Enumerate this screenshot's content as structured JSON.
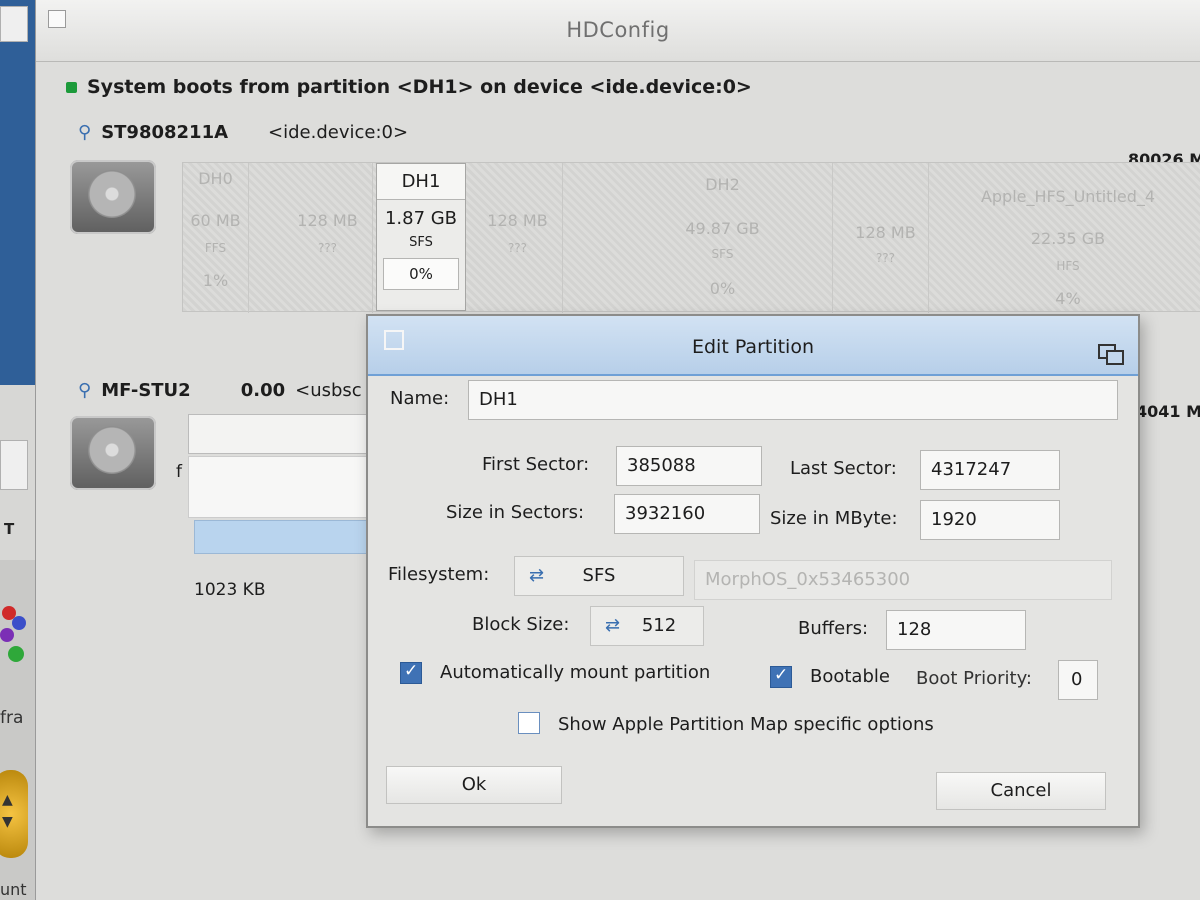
{
  "window": {
    "title": "HDConfig"
  },
  "boot_status": "System boots from partition <DH1> on device <ide.device:0>",
  "devices": [
    {
      "name": "ST9808211A",
      "path": "<ide.device:0>",
      "size": "80026 M",
      "partitions": [
        {
          "name": "DH0",
          "size": "60 MB",
          "fs": "FFS",
          "used": "1%"
        },
        {
          "name": "",
          "size": "128 MB",
          "fs": "???",
          "used": ""
        },
        {
          "name": "DH1",
          "size": "1.87 GB",
          "fs": "SFS",
          "used": "0%",
          "selected": true
        },
        {
          "name": "",
          "size": "128 MB",
          "fs": "???",
          "used": ""
        },
        {
          "name": "DH2",
          "size": "49.87 GB",
          "fs": "SFS",
          "used": "0%"
        },
        {
          "name": "",
          "size": "128 MB",
          "fs": "???",
          "used": ""
        },
        {
          "name": "Apple_HFS_Untitled_4",
          "size": "22.35 GB",
          "fs": "HFS",
          "used": "4%"
        }
      ]
    },
    {
      "name": "MF-STU2",
      "capacity": "0.00",
      "path": "<usbsc",
      "size": "4041 M",
      "free_text": "1023 KB",
      "frag": "f"
    }
  ],
  "left_strip": {
    "frag_top": "T",
    "frag_mid": "fra",
    "frag_bottom": "unt"
  },
  "dialog": {
    "title": "Edit Partition",
    "name_label": "Name:",
    "name_value": "DH1",
    "first_sector_label": "First Sector:",
    "first_sector_value": "385088",
    "last_sector_label": "Last Sector:",
    "last_sector_value": "4317247",
    "size_sectors_label": "Size in Sectors:",
    "size_sectors_value": "3932160",
    "size_mbyte_label": "Size in MByte:",
    "size_mbyte_value": "1920",
    "filesystem_label": "Filesystem:",
    "filesystem_value": "SFS",
    "filesystem_id": "MorphOS_0x53465300",
    "block_size_label": "Block Size:",
    "block_size_value": "512",
    "buffers_label": "Buffers:",
    "buffers_value": "128",
    "automount_label": "Automatically mount partition",
    "automount_checked": true,
    "bootable_label": "Bootable",
    "bootable_checked": true,
    "boot_priority_label": "Boot Priority:",
    "boot_priority_value": "0",
    "apple_map_label": "Show Apple Partition Map specific options",
    "apple_map_checked": false,
    "ok_label": "Ok",
    "cancel_label": "Cancel"
  }
}
